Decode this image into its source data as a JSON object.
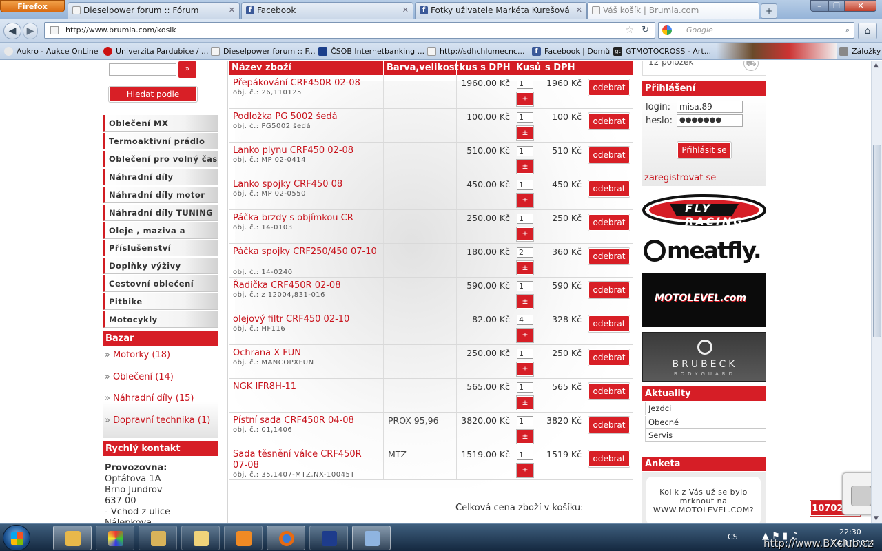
{
  "browser": {
    "menu_label": "Firefox",
    "tabs": [
      {
        "title": "Dieselpower forum :: Fórum",
        "icon": "page-icon",
        "color": "#f4f4f4"
      },
      {
        "title": "Facebook",
        "icon": "facebook-icon",
        "color": "#3b5998"
      },
      {
        "title": "Fotky uživatele Markéta Kurešová",
        "icon": "facebook-icon",
        "color": "#3b5998"
      },
      {
        "title": "Váš košík | Brumla.com",
        "icon": "page-icon",
        "color": "#f4f4f4"
      }
    ],
    "url": "http://www.brumla.com/kosik",
    "search_placeholder": "Google",
    "bookmarks": [
      {
        "label": "Aukro - Aukce OnLine",
        "icon": "aukro-icon",
        "color": "#e8e8e8"
      },
      {
        "label": "Univerzita Pardubice / ...",
        "icon": "university-icon",
        "color": "#cc1111"
      },
      {
        "label": "Dieselpower forum :: F...",
        "icon": "page-icon",
        "color": "#f4f4f4"
      },
      {
        "label": "ČSOB Internetbanking ...",
        "icon": "bank-icon",
        "color": "#1b3f8b"
      },
      {
        "label": "http://sdhchlumecnc...",
        "icon": "page-icon",
        "color": "#f4f4f4"
      },
      {
        "label": "Facebook | Domů",
        "icon": "facebook-icon",
        "color": "#3b5998"
      },
      {
        "label": "GTMOTOCROSS - Art...",
        "icon": "gt-icon",
        "color": "#222222"
      }
    ],
    "bookmarks_menu": "Záložky"
  },
  "left": {
    "search_go": "»",
    "search_by_bike": "Hledat podle motorky",
    "categories": [
      "Oblečení MX",
      "Termoaktivní prádlo",
      "Oblečení pro volný čas",
      "Náhradní díly podvozek",
      "Náhradní díly motor",
      "Náhradní díly TUNING",
      "Oleje , maziva a lepidla",
      "Příslušenství",
      "Doplňky výživy",
      "Cestovní oblečení",
      "Pitbike",
      "Motocykly"
    ],
    "bazar_title": "Bazar",
    "bazar_links": [
      "Motorky (18)",
      "Oblečení (14)",
      "Náhradní díly (15)",
      "Dopravní technika (1)"
    ],
    "contact_title": "Rychlý kontakt",
    "contact_lines": [
      "Provozovna:",
      "Optátova 1A",
      "Brno Jundrov",
      "637 00",
      "- Vchod z ulice Nálepkova"
    ]
  },
  "cart": {
    "headers": [
      "Název zboží",
      "Barva,velikost",
      "kus s DPH",
      "Kusů",
      "s DPH"
    ],
    "qty_button": "±",
    "remove_label": "odebrat",
    "items": [
      {
        "name": "Přepákování CRF450R 02-08",
        "code": "obj. č.: 26,110125",
        "color": "",
        "price": "1960.00 Kč",
        "qty": "1",
        "total": "1960 Kč"
      },
      {
        "name": "Podložka PG 5002 šedá",
        "code": "obj. č.: PG5002 šedá",
        "color": "",
        "price": "100.00 Kč",
        "qty": "1",
        "total": "100 Kč"
      },
      {
        "name": "Lanko plynu CRF450 02-08",
        "code": "obj. č.: MP 02-0414",
        "color": "",
        "price": "510.00 Kč",
        "qty": "1",
        "total": "510 Kč"
      },
      {
        "name": "Lanko spojky CRF450 08",
        "code": "obj. č.: MP 02-0550",
        "color": "",
        "price": "450.00 Kč",
        "qty": "1",
        "total": "450 Kč"
      },
      {
        "name": "Páčka brzdy s objímkou CR",
        "code": "obj. č.: 14-0103",
        "color": "",
        "price": "250.00 Kč",
        "qty": "1",
        "total": "250 Kč"
      },
      {
        "name": "Páčka spojky CRF250/450 07-10",
        "code": "obj. č.: 14-0240",
        "color": "",
        "price": "180.00 Kč",
        "qty": "2",
        "total": "360 Kč"
      },
      {
        "name": "Řadička CRF450R 02-08",
        "code": "obj. č.: z 12004,831-016",
        "color": "",
        "price": "590.00 Kč",
        "qty": "1",
        "total": "590 Kč"
      },
      {
        "name": "olejový filtr CRF450 02-10",
        "code": "obj. č.: HF116",
        "color": "",
        "price": "82.00 Kč",
        "qty": "4",
        "total": "328 Kč"
      },
      {
        "name": "Ochrana X FUN",
        "code": "obj. č.: MANCOPXFUN",
        "color": "",
        "price": "250.00 Kč",
        "qty": "1",
        "total": "250 Kč"
      },
      {
        "name": "NGK IFR8H-11",
        "code": "",
        "color": "",
        "price": "565.00 Kč",
        "qty": "1",
        "total": "565 Kč"
      },
      {
        "name": "Pístní sada CRF450R 04-08",
        "code": "obj. č.: 01,1406",
        "color": "PROX 95,96",
        "price": "3820.00 Kč",
        "qty": "1",
        "total": "3820 Kč"
      },
      {
        "name": "Sada těsnění válce CRF450R 07-08",
        "code": "obj. č.: 35,1407-MTZ,NX-10045T",
        "color": "MTZ",
        "price": "1519.00 Kč",
        "qty": "1",
        "total": "1519 Kč"
      }
    ],
    "total_label": "Celková cena zboží v košíku:",
    "total_value": "10702 Kč"
  },
  "right": {
    "cart_count": "12 položek",
    "login_title": "Přihlášení",
    "login_label": "login:",
    "login_value": "misa.89",
    "password_label": "heslo:",
    "password_value": "●●●●●●●",
    "login_button": "Přihlásit se",
    "register_link": "zaregistrovat se",
    "logos": [
      "FLY RACING",
      "meatfly.",
      "MOTOLEVEL.com",
      "BRUBECK",
      "BODYGUARD"
    ],
    "news_title": "Aktuality",
    "news_items": [
      "Jezdci",
      "Obecné",
      "Servis"
    ],
    "poll_title": "Anketa",
    "poll_question": "Kolik z Vás už se bylo mrknout na WWW.MOTOLEVEL.COM?"
  },
  "taskbar": {
    "language": "CS",
    "time": "22:30",
    "date": "24.11.2011",
    "watermark": "http://www.BXclub.cz"
  },
  "colors": {
    "brand_red": "#d61e26",
    "link_red": "#c8141d"
  }
}
